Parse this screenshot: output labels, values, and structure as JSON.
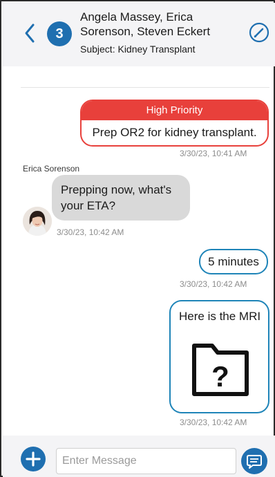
{
  "header": {
    "participant_count": "3",
    "participants": "Angela Massey, Erica Sorenson, Steven Eckert",
    "subject": "Subject: Kidney Transplant"
  },
  "messages": {
    "priority_label": "High Priority",
    "msg1_text": "Prep OR2 for kidney transplant.",
    "msg1_time": "3/30/23, 10:41 AM",
    "msg2_sender": "Erica Sorenson",
    "msg2_text": "Prepping now, what's your ETA?",
    "msg2_time": "3/30/23, 10:42 AM",
    "msg3_text": "5 minutes",
    "msg3_time": "3/30/23, 10:42 AM",
    "msg4_text": "Here is the MRI",
    "msg4_time": "3/30/23, 10:42 AM"
  },
  "composer": {
    "placeholder": "Enter Message"
  },
  "colors": {
    "accent": "#1f6fb0",
    "priority": "#e8403b",
    "outgoing_border": "#1e84b8",
    "incoming_bg": "#d9d9d9"
  },
  "icons": {
    "back": "chevron-left-icon",
    "edit": "pencil-circle-icon",
    "attachment": "folder-question-icon",
    "add": "plus-icon",
    "send": "chat-bubble-icon"
  }
}
